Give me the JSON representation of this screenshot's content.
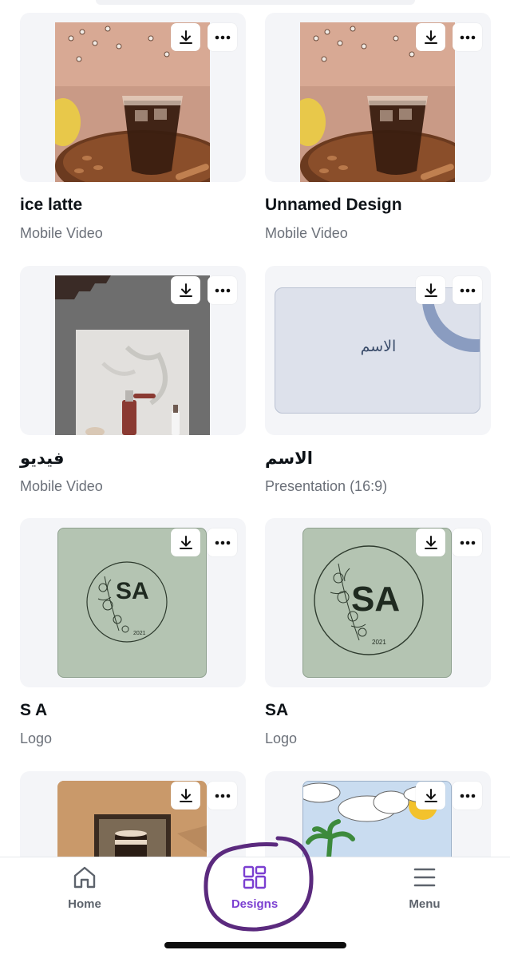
{
  "designs": [
    {
      "title": "ice latte",
      "subtitle": "Mobile Video",
      "thumb": "iced-coffee-photo"
    },
    {
      "title": "Unnamed Design",
      "subtitle": "Mobile Video",
      "thumb": "iced-coffee-photo"
    },
    {
      "title": "فيديو",
      "subtitle": "Mobile Video",
      "thumb": "serum-bottle-photo"
    },
    {
      "title": "الاسم",
      "subtitle": "Presentation (16:9)",
      "thumb": "presentation-slide",
      "thumb_text": "الاسم"
    },
    {
      "title": "S A",
      "subtitle": "Logo",
      "thumb": "floral-logo",
      "thumb_text": "SA",
      "thumb_year": "2021"
    },
    {
      "title": "SA",
      "subtitle": "Logo",
      "thumb": "floral-logo",
      "thumb_text": "SA",
      "thumb_year": "2021"
    },
    {
      "title": "",
      "subtitle": "",
      "thumb": "candle-photo"
    },
    {
      "title": "",
      "subtitle": "",
      "thumb": "cartoon-sky"
    }
  ],
  "icons": {
    "download": "download-icon",
    "more": "more-options-icon"
  },
  "nav": {
    "home_label": "Home",
    "designs_label": "Designs",
    "menu_label": "Menu",
    "active": "designs"
  },
  "colors": {
    "accent": "#7b3fd1",
    "card_bg": "#f4f5f8",
    "subtitle": "#6b7079",
    "annotation_circle": "#5b2a7e"
  }
}
